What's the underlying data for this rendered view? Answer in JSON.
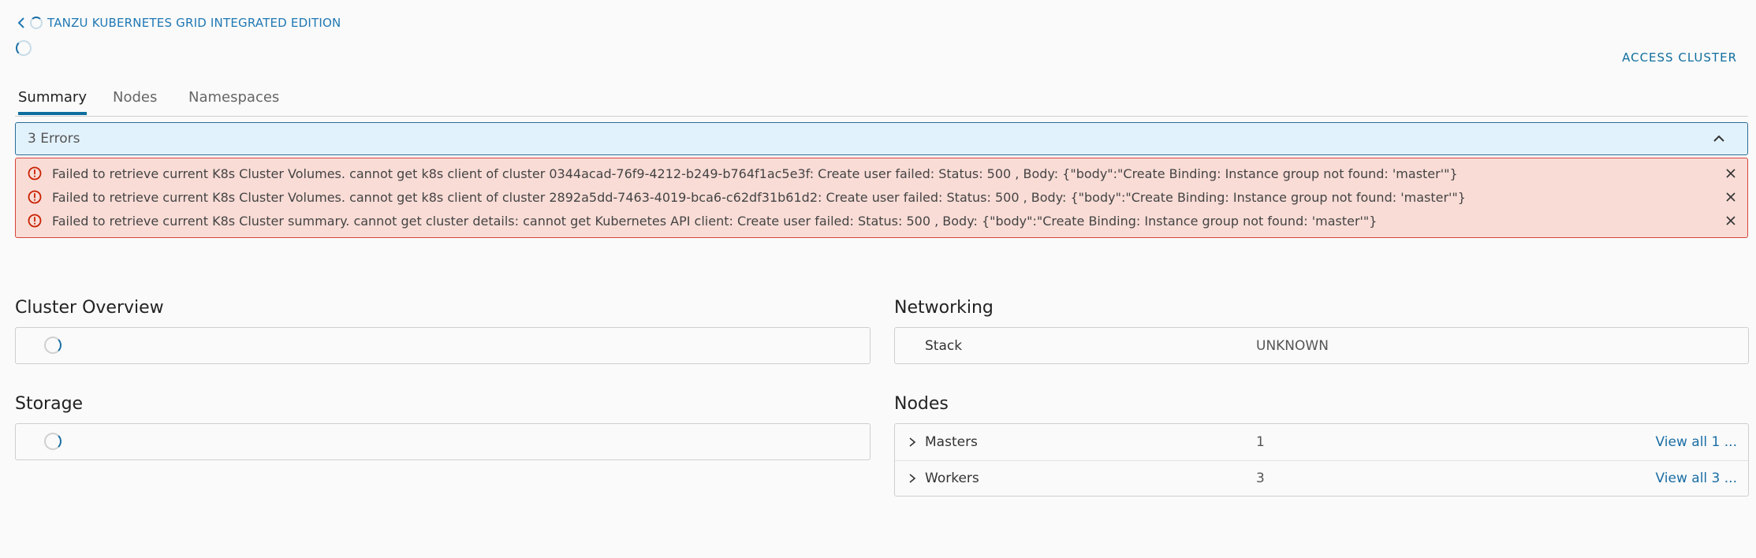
{
  "breadcrumb": {
    "label": "TANZU KUBERNETES GRID INTEGRATED EDITION"
  },
  "header": {
    "access_cluster": "ACCESS CLUSTER"
  },
  "tabs": [
    {
      "label": "Summary",
      "active": true
    },
    {
      "label": "Nodes",
      "active": false
    },
    {
      "label": "Namespaces",
      "active": false
    }
  ],
  "errors": {
    "summary": "3 Errors",
    "items": [
      "Failed to retrieve current K8s Cluster Volumes. cannot get k8s client of cluster 0344acad-76f9-4212-b249-b764f1ac5e3f: Create user failed: Status: 500 , Body: {\"body\":\"Create Binding: Instance group not found: 'master'\"}",
      "Failed to retrieve current K8s Cluster Volumes. cannot get k8s client of cluster 2892a5dd-7463-4019-bca6-c62df31b61d2: Create user failed: Status: 500 , Body: {\"body\":\"Create Binding: Instance group not found: 'master'\"}",
      "Failed to retrieve current K8s Cluster summary. cannot get cluster details: cannot get Kubernetes API client: Create user failed: Status: 500 , Body: {\"body\":\"Create Binding: Instance group not found: 'master'\"}"
    ]
  },
  "cluster_overview": {
    "title": "Cluster Overview"
  },
  "storage": {
    "title": "Storage"
  },
  "networking": {
    "title": "Networking",
    "rows": [
      {
        "key": "Stack",
        "value": "UNKNOWN"
      }
    ]
  },
  "nodes": {
    "title": "Nodes",
    "rows": [
      {
        "key": "Masters",
        "value": "1",
        "link": "View all 1 ..."
      },
      {
        "key": "Workers",
        "value": "3",
        "link": "View all 3 ..."
      }
    ]
  },
  "colors": {
    "accent": "#0f6e9f",
    "error_bg": "#f9dcd6",
    "error_border": "#d6443a",
    "info_bg": "#e2f2fd"
  }
}
